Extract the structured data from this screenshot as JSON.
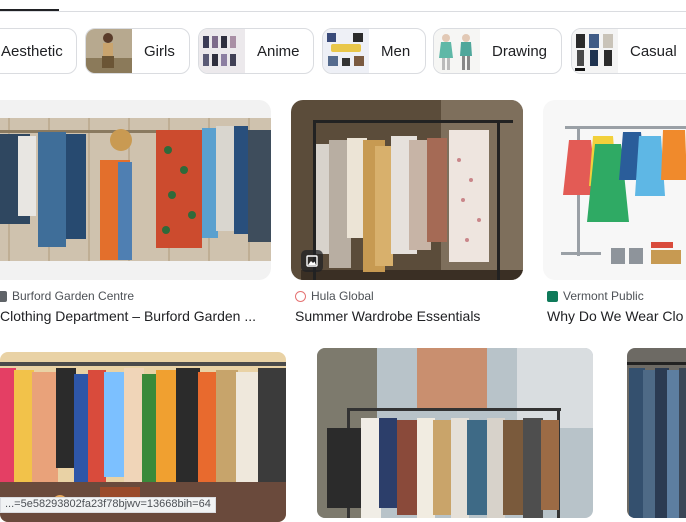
{
  "chips": [
    {
      "label": "Aesthetic"
    },
    {
      "label": "Girls"
    },
    {
      "label": "Anime"
    },
    {
      "label": "Men"
    },
    {
      "label": "Drawing"
    },
    {
      "label": "Casual"
    }
  ],
  "results": [
    {
      "source": "Burford Garden Centre",
      "title": "Clothing Department – Burford Garden ..."
    },
    {
      "source": "Hula Global",
      "title": "Summer Wardrobe Essentials"
    },
    {
      "source": "Vermont Public",
      "title": "Why Do We Wear Clo"
    }
  ],
  "status_url": "...=5e58293802fa23f78bjwv=13668bih=64"
}
